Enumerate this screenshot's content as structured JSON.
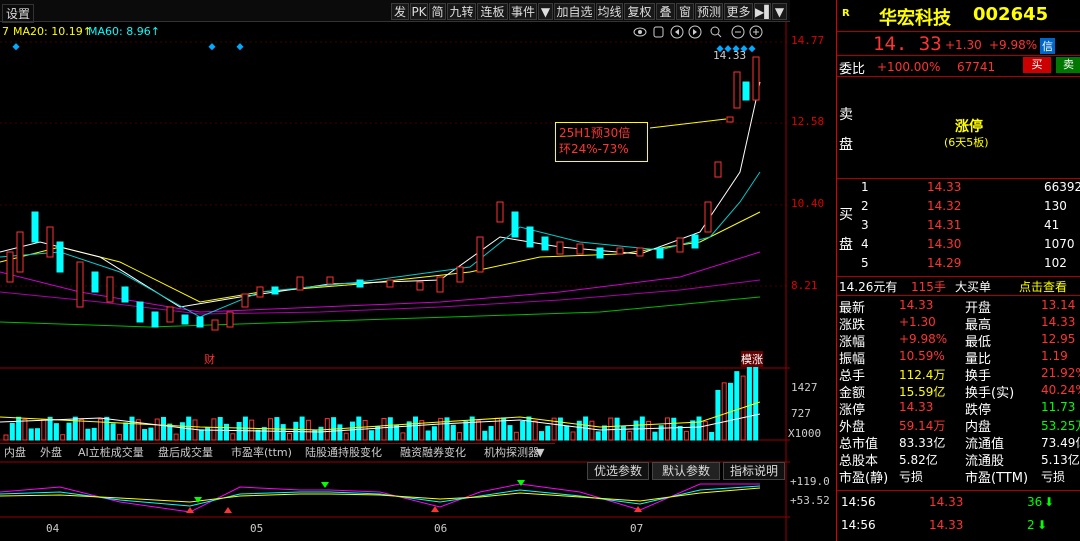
{
  "toolbar": {
    "settings": "设置",
    "tabs": [
      "发",
      "PK",
      "简",
      "九转",
      "连板",
      "事件",
      "▼",
      "加自选",
      "均线",
      "复权",
      "叠",
      "窗",
      "预测",
      "更多",
      "▶▌",
      "▼"
    ]
  },
  "ma": {
    "ma5": "7",
    "ma20": "MA20: 10.19↑",
    "ma60": "MA60: 8.96↑"
  },
  "axis": {
    "p1": "14.77",
    "p2": "12.58",
    "p3": "10.40",
    "p4": "8.21",
    "v1": "1427",
    "v2": "727",
    "v3": "X1000",
    "m1": "+119.0",
    "m2": "+53.52",
    "x1": "04",
    "x2": "05",
    "x3": "06",
    "x4": "07",
    "hi": "14.33"
  },
  "annotation": {
    "line1": "25H1预30倍",
    "line2": "环24%-73%"
  },
  "events": {
    "cai": "财",
    "jiangzhang": "模涨"
  },
  "bottom_tabs": [
    "内盘",
    "外盘",
    "AI立桩成交量",
    "盘后成交量",
    "市盈率(ttm)",
    "陆股通持股变化",
    "融资融券变化",
    "机构探测器",
    "▼"
  ],
  "params": {
    "p1": "优选参数",
    "p2": "默认参数",
    "p3": "指标说明"
  },
  "stock": {
    "name": "华宏科技",
    "code": "002645",
    "price": "14. 33",
    "change": "+1.30",
    "pct": "+9.98%",
    "tag": "信"
  },
  "weibi": {
    "label": "委比",
    "pct": "+100.00%",
    "num": "67741",
    "buy": "买",
    "sell": "卖"
  },
  "sell_label": "卖\n盘",
  "buy_label": "买\n盘",
  "limit": {
    "title": "涨停",
    "sub": "(6天5板)"
  },
  "bids": [
    {
      "n": "1",
      "p": "14.33",
      "v": "66392"
    },
    {
      "n": "2",
      "p": "14.32",
      "v": "130"
    },
    {
      "n": "3",
      "p": "14.31",
      "v": "41"
    },
    {
      "n": "4",
      "p": "14.30",
      "v": "1070"
    },
    {
      "n": "5",
      "p": "14.29",
      "v": "102"
    }
  ],
  "bigline": {
    "a": "14.26元有",
    "b": "115手",
    "c": "大买单",
    "d": "点击查看"
  },
  "quotes": [
    [
      "最新",
      "14.33",
      "开盘",
      "13.14"
    ],
    [
      "涨跌",
      "+1.30",
      "最高",
      "14.33"
    ],
    [
      "涨幅",
      "+9.98%",
      "最低",
      "12.95"
    ],
    [
      "振幅",
      "10.59%",
      "量比",
      "1.19"
    ],
    [
      "总手",
      "112.4万",
      "换手",
      "21.92%"
    ],
    [
      "金额",
      "15.59亿",
      "换手(实)",
      "40.24%"
    ],
    [
      "涨停",
      "14.33",
      "跌停",
      "11.73"
    ],
    [
      "外盘",
      "59.14万",
      "内盘",
      "53.25万"
    ],
    [
      "总市值",
      "83.33亿",
      "流通值",
      "73.49亿"
    ],
    [
      "总股本",
      "5.82亿",
      "流通股",
      "5.13亿"
    ],
    [
      "市盈(静)",
      "亏损",
      "市盈(TTM)",
      "亏损"
    ]
  ],
  "ticks": [
    {
      "t": "14:56",
      "p": "14.33",
      "v": "36",
      "dir": "down"
    },
    {
      "t": "14:56",
      "p": "14.33",
      "v": "2",
      "dir": "down"
    }
  ]
}
